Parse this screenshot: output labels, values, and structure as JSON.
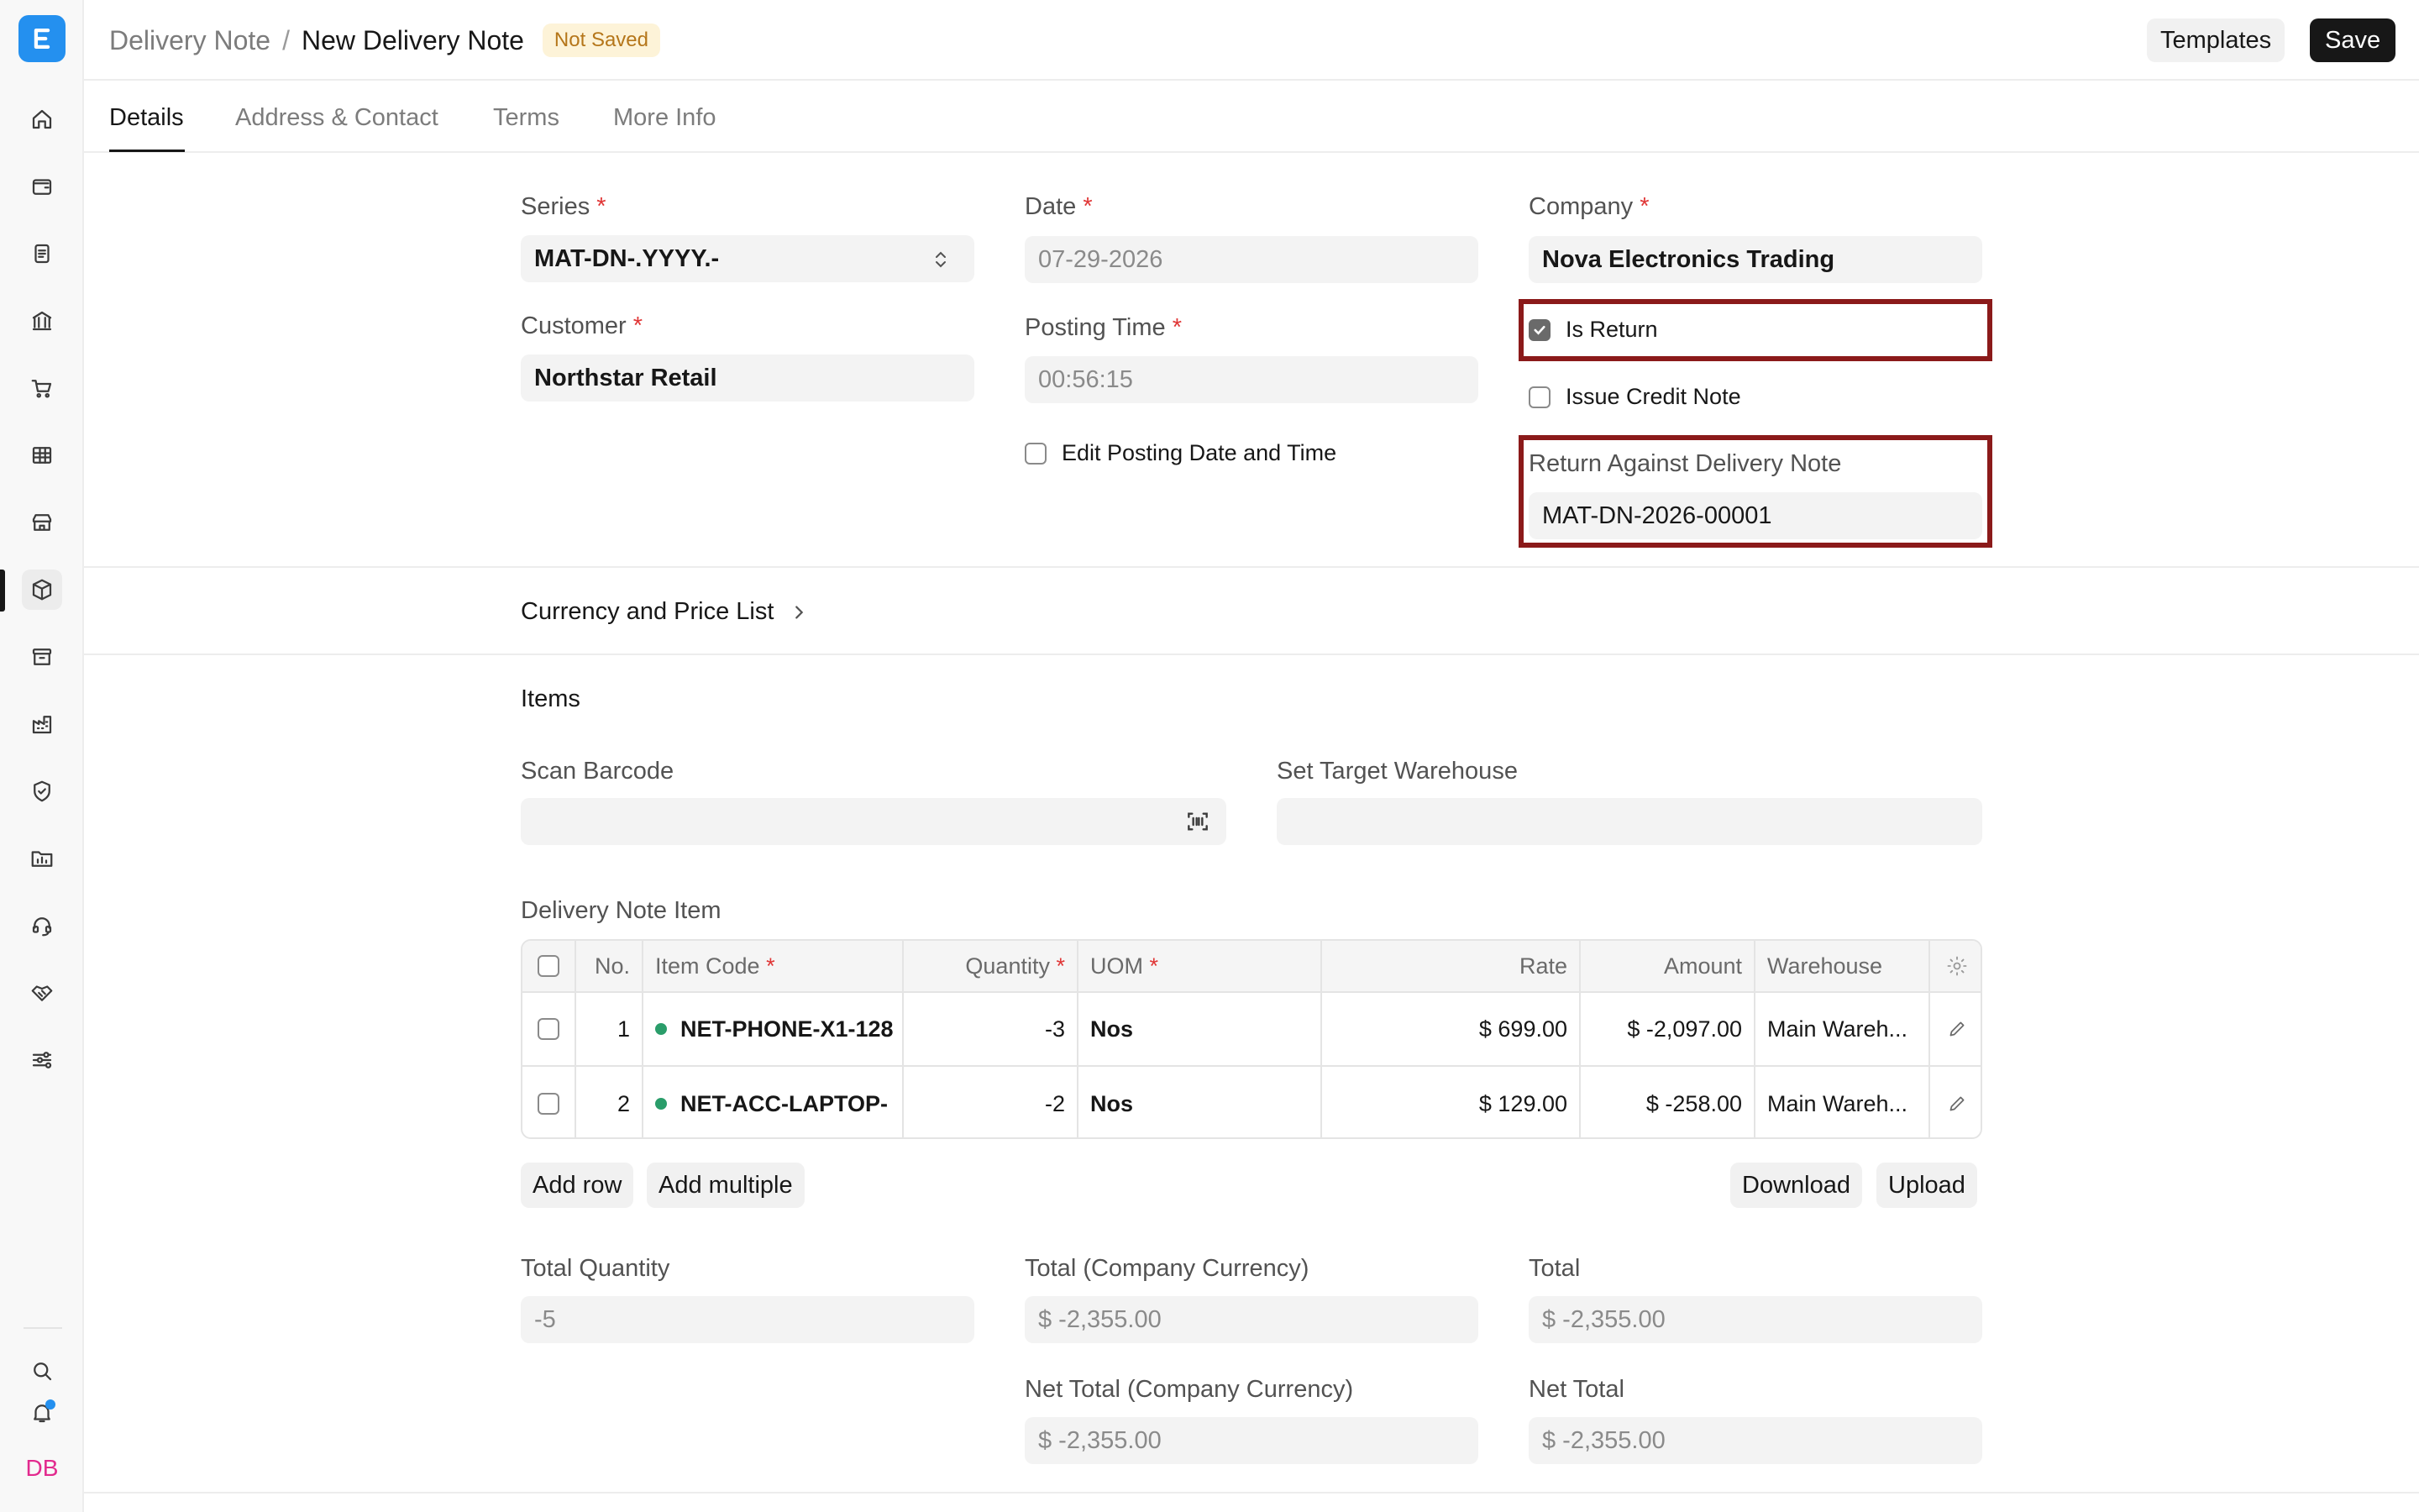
{
  "sidebar": {
    "logo": "E",
    "items": [
      {
        "icon": "home-icon"
      },
      {
        "icon": "wallet-icon"
      },
      {
        "icon": "document-icon"
      },
      {
        "icon": "bank-icon"
      },
      {
        "icon": "cart-icon"
      },
      {
        "icon": "table-icon"
      },
      {
        "icon": "store-icon"
      },
      {
        "icon": "package-icon"
      },
      {
        "icon": "archive-icon"
      },
      {
        "icon": "building-icon"
      },
      {
        "icon": "shield-icon"
      },
      {
        "icon": "chart-folder-icon"
      },
      {
        "icon": "headset-icon"
      },
      {
        "icon": "handshake-icon"
      },
      {
        "icon": "sliders-icon"
      }
    ],
    "bottom": {
      "search_icon": "search-icon",
      "bell_icon": "bell-icon",
      "avatar_initials": "DB"
    }
  },
  "header": {
    "breadcrumb_parent": "Delivery Note",
    "breadcrumb_sep": "/",
    "title": "New Delivery Note",
    "status_badge": "Not Saved",
    "templates_label": "Templates",
    "save_label": "Save"
  },
  "tabs": [
    {
      "label": "Details",
      "active": true
    },
    {
      "label": "Address & Contact"
    },
    {
      "label": "Terms"
    },
    {
      "label": "More Info"
    }
  ],
  "form": {
    "series_label": "Series",
    "series_value": "MAT-DN-.YYYY.-",
    "customer_label": "Customer",
    "customer_value": "Northstar Retail",
    "date_label": "Date",
    "date_value": "07-29-2026",
    "posting_time_label": "Posting Time",
    "posting_time_value": "00:56:15",
    "edit_posting_label": "Edit Posting Date and Time",
    "edit_posting_checked": false,
    "company_label": "Company",
    "company_value": "Nova Electronics Trading",
    "is_return_label": "Is Return",
    "is_return_checked": true,
    "issue_credit_note_label": "Issue Credit Note",
    "issue_credit_note_checked": false,
    "return_against_label": "Return Against Delivery Note",
    "return_against_value": "MAT-DN-2026-00001",
    "required_mark": "*"
  },
  "currency_section": {
    "label": "Currency and Price List"
  },
  "items_section": {
    "title": "Items",
    "scan_barcode_label": "Scan Barcode",
    "scan_barcode_value": "",
    "target_warehouse_label": "Set Target Warehouse",
    "target_warehouse_value": "",
    "table_label": "Delivery Note Item",
    "columns": {
      "no": "No.",
      "item_code": "Item Code",
      "quantity": "Quantity",
      "uom": "UOM",
      "rate": "Rate",
      "amount": "Amount",
      "warehouse": "Warehouse"
    },
    "rows": [
      {
        "no": "1",
        "item_code": "NET-PHONE-X1-128",
        "quantity": "-3",
        "uom": "Nos",
        "rate": "$ 699.00",
        "amount": "$ -2,097.00",
        "warehouse": "Main Wareh..."
      },
      {
        "no": "2",
        "item_code": "NET-ACC-LAPTOP-",
        "quantity": "-2",
        "uom": "Nos",
        "rate": "$ 129.00",
        "amount": "$ -258.00",
        "warehouse": "Main Wareh..."
      }
    ],
    "add_row_label": "Add row",
    "add_multiple_label": "Add multiple",
    "download_label": "Download",
    "upload_label": "Upload"
  },
  "totals": {
    "total_qty_label": "Total Quantity",
    "total_qty_value": "-5",
    "total_company_label": "Total (Company Currency)",
    "total_company_value": "$ -2,355.00",
    "total_label": "Total",
    "total_value": "$ -2,355.00",
    "net_total_company_label": "Net Total (Company Currency)",
    "net_total_company_value": "$ -2,355.00",
    "net_total_label": "Net Total",
    "net_total_value": "$ -2,355.00"
  },
  "colors": {
    "brand": "#2490ef",
    "highlight_border": "#8b1a1a",
    "status_dot": "#2a9d6a",
    "badge_bg": "#fdf3d8",
    "badge_text": "#b5761a"
  }
}
